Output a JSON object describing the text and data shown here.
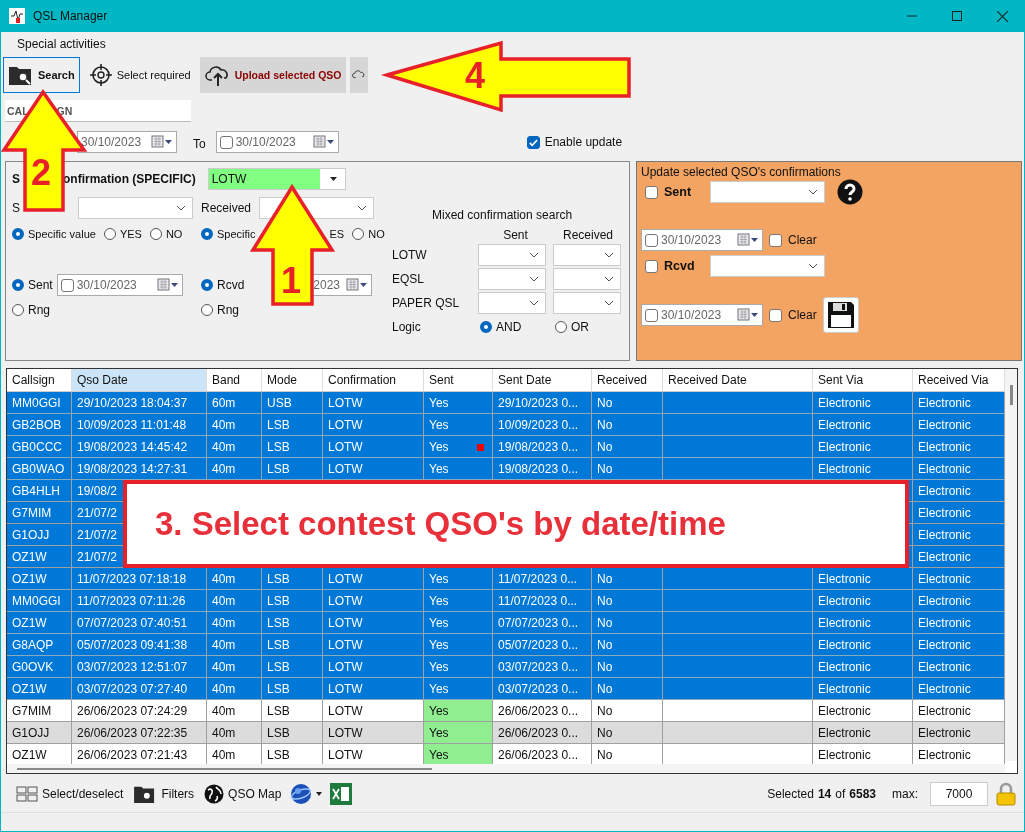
{
  "window": {
    "title": "QSL Manager"
  },
  "menu": [
    {
      "label": "Special activities"
    }
  ],
  "toolbar": [
    {
      "kind": "search",
      "label": "Search",
      "selected": true
    },
    {
      "kind": "target",
      "label": "Select required",
      "selected": false
    },
    {
      "kind": "upload",
      "label": "Upload selected QSO",
      "selected": false
    },
    {
      "kind": "cloud",
      "selected": false
    }
  ],
  "callsign_field": {
    "visible_parts": [
      "CAL",
      "GN"
    ]
  },
  "date_range": {
    "from_date": "30/10/2023",
    "to_label": "To",
    "to_checked": false,
    "to_date": "30/10/2023"
  },
  "enable_update": {
    "label": "Enable update",
    "checked": true
  },
  "search_panel": {
    "title_parts": [
      "S",
      "onfirmation (SPECIFIC)"
    ],
    "confirmation_type": "LOTW",
    "sent": {
      "label": "S",
      "modes": [
        {
          "label": "Specific value",
          "selected": true
        },
        {
          "label": "YES",
          "selected": false
        },
        {
          "label": "NO",
          "selected": false
        }
      ],
      "date_options": [
        {
          "label": "Sent",
          "selected": true
        },
        {
          "label": "Rng",
          "selected": false
        }
      ],
      "date_checked": false,
      "date": "30/10/2023"
    },
    "received": {
      "label": "Received",
      "modes": [
        {
          "label": "Specific",
          "selected": true
        },
        {
          "label": "ES"
        },
        {
          "label": "NO",
          "selected": false
        }
      ],
      "date_options": [
        {
          "label": "Rcvd",
          "selected": true
        },
        {
          "label": "Rng",
          "selected": false
        }
      ],
      "date": "2023"
    },
    "mixed": {
      "title": "Mixed confirmation search",
      "columns": [
        "Sent",
        "Received"
      ],
      "rows": [
        "LOTW",
        "EQSL",
        "PAPER QSL"
      ],
      "logic_label": "Logic",
      "logic": [
        {
          "label": "AND",
          "selected": true
        },
        {
          "label": "OR",
          "selected": false
        }
      ]
    }
  },
  "update_panel": {
    "title": "Update selected QSO's confirmations",
    "items": [
      {
        "label": "Sent",
        "checked": false,
        "date_checked": false,
        "date": "30/10/2023",
        "clear_label": "Clear",
        "clear_checked": false
      },
      {
        "label": "Rcvd",
        "checked": false,
        "date_checked": false,
        "date": "30/10/2023",
        "clear_label": "Clear",
        "clear_checked": false
      }
    ]
  },
  "table": {
    "columns": [
      {
        "label": "Callsign",
        "sorted": false
      },
      {
        "label": "Qso Date",
        "sorted": true
      },
      {
        "label": "Band",
        "sorted": false
      },
      {
        "label": "Mode",
        "sorted": false
      },
      {
        "label": "Confirmation",
        "sorted": false
      },
      {
        "label": "Sent",
        "sorted": false
      },
      {
        "label": "Sent Date",
        "sorted": false
      },
      {
        "label": "Received",
        "sorted": false
      },
      {
        "label": "Received Date",
        "sorted": false
      },
      {
        "label": "Sent Via",
        "sorted": false
      },
      {
        "label": "Received Via",
        "sorted": false
      }
    ],
    "rows": [
      {
        "selected": true,
        "confirmed": true,
        "flagged": false,
        "cells": [
          "MM0GGI",
          "29/10/2023 18:04:37",
          "60m",
          "USB",
          "LOTW",
          "Yes",
          "29/10/2023 0...",
          "No",
          null,
          "Electronic",
          "Electronic"
        ]
      },
      {
        "selected": true,
        "confirmed": true,
        "flagged": false,
        "cells": [
          "GB2BOB",
          "10/09/2023 11:01:48",
          "40m",
          "LSB",
          "LOTW",
          "Yes",
          "10/09/2023 0...",
          "No",
          null,
          "Electronic",
          "Electronic"
        ]
      },
      {
        "selected": true,
        "confirmed": true,
        "flagged": true,
        "cells": [
          "GB0CCC",
          "19/08/2023 14:45:42",
          "40m",
          "LSB",
          "LOTW",
          "Yes",
          "19/08/2023 0...",
          "No",
          null,
          "Electronic",
          "Electronic"
        ]
      },
      {
        "selected": true,
        "confirmed": true,
        "flagged": false,
        "cells": [
          "GB0WAO",
          "19/08/2023 14:27:31",
          "40m",
          "LSB",
          "LOTW",
          "Yes",
          "19/08/2023 0...",
          "No",
          null,
          "Electronic",
          "Electronic"
        ]
      },
      {
        "selected": true,
        "cells": [
          "GB4HLH",
          "19/08/2",
          null,
          null,
          null,
          null,
          null,
          null,
          null,
          null,
          "Electronic"
        ]
      },
      {
        "selected": true,
        "cells": [
          "G7MIM",
          "21/07/2",
          null,
          null,
          null,
          null,
          null,
          null,
          null,
          null,
          "Electronic"
        ]
      },
      {
        "selected": true,
        "cells": [
          "G1OJJ",
          "21/07/2",
          null,
          null,
          null,
          null,
          null,
          null,
          null,
          null,
          "Electronic"
        ]
      },
      {
        "selected": true,
        "cells": [
          "OZ1W",
          "21/07/2",
          null,
          null,
          null,
          null,
          null,
          null,
          null,
          null,
          "Electronic"
        ]
      },
      {
        "selected": true,
        "confirmed": true,
        "flagged": false,
        "cells": [
          "OZ1W",
          "11/07/2023 07:18:18",
          "40m",
          "LSB",
          "LOTW",
          "Yes",
          "11/07/2023 0...",
          "No",
          null,
          "Electronic",
          "Electronic"
        ]
      },
      {
        "selected": true,
        "confirmed": true,
        "flagged": false,
        "cells": [
          "MM0GGI",
          "11/07/2023 07:11:26",
          "40m",
          "LSB",
          "LOTW",
          "Yes",
          "11/07/2023 0...",
          "No",
          null,
          "Electronic",
          "Electronic"
        ]
      },
      {
        "selected": true,
        "confirmed": true,
        "flagged": false,
        "cells": [
          "OZ1W",
          "07/07/2023 07:40:51",
          "40m",
          "LSB",
          "LOTW",
          "Yes",
          "07/07/2023 0...",
          "No",
          null,
          "Electronic",
          "Electronic"
        ]
      },
      {
        "selected": true,
        "confirmed": true,
        "flagged": false,
        "cells": [
          "G8AQP",
          "05/07/2023 09:41:38",
          "40m",
          "LSB",
          "LOTW",
          "Yes",
          "05/07/2023 0...",
          "No",
          null,
          "Electronic",
          "Electronic"
        ]
      },
      {
        "selected": true,
        "confirmed": true,
        "flagged": false,
        "cells": [
          "G0OVK",
          "03/07/2023 12:51:07",
          "40m",
          "LSB",
          "LOTW",
          "Yes",
          "03/07/2023 0...",
          "No",
          null,
          "Electronic",
          "Electronic"
        ]
      },
      {
        "selected": true,
        "confirmed": true,
        "flagged": false,
        "cells": [
          "OZ1W",
          "03/07/2023 07:27:40",
          "40m",
          "LSB",
          "LOTW",
          "Yes",
          "03/07/2023 0...",
          "No",
          null,
          "Electronic",
          "Electronic"
        ]
      },
      {
        "selected": false,
        "confirmed": true,
        "flagged": false,
        "cells": [
          "G7MIM",
          "26/06/2023 07:24:29",
          "40m",
          "LSB",
          "LOTW",
          "Yes",
          "26/06/2023 0...",
          "No",
          null,
          "Electronic",
          "Electronic"
        ]
      },
      {
        "selected": false,
        "confirmed": true,
        "flagged": false,
        "cells": [
          "G1OJJ",
          "26/06/2023 07:22:35",
          "40m",
          "LSB",
          "LOTW",
          "Yes",
          "26/06/2023 0...",
          "No",
          null,
          "Electronic",
          "Electronic"
        ]
      },
      {
        "selected": false,
        "confirmed": true,
        "flagged": false,
        "cells": [
          "OZ1W",
          "26/06/2023 07:21:43",
          "40m",
          "LSB",
          "LOTW",
          "Yes",
          "26/06/2023 0...",
          "No",
          null,
          "Electronic",
          "Electronic"
        ]
      }
    ]
  },
  "bottom_bar": {
    "tools": [
      {
        "kind": "grid",
        "label": "Select/deselect"
      },
      {
        "kind": "folder",
        "label": "Filters"
      },
      {
        "kind": "globe",
        "label": "QSO Map"
      },
      {
        "kind": "earth-menu"
      },
      {
        "kind": "sheet"
      }
    ],
    "selected_label": "Selected",
    "selected_count": "14",
    "of_label": "of",
    "total": "6583",
    "max_label": "max:",
    "max_value": "7000",
    "locked": true
  },
  "annotations": [
    {
      "kind": "up-arrow",
      "number": "1"
    },
    {
      "kind": "up-arrow",
      "number": "2"
    },
    {
      "kind": "callout",
      "text": "3. Select contest QSO's by date/time"
    },
    {
      "kind": "left-arrow",
      "number": "4"
    }
  ]
}
